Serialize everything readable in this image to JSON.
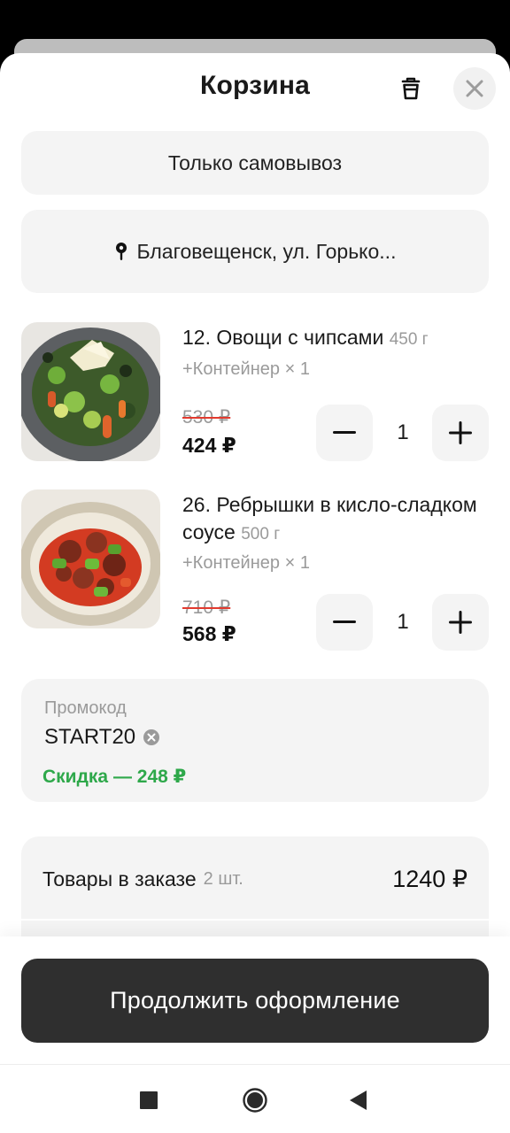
{
  "header": {
    "title": "Корзина"
  },
  "icons": {
    "trash": "trash-icon",
    "close": "close-icon",
    "pin": "location-pin-icon",
    "minus": "minus-icon",
    "plus": "plus-icon",
    "clear": "clear-circle-icon",
    "recents": "square-icon",
    "home": "circle-icon",
    "back": "triangle-back-icon"
  },
  "delivery": {
    "mode_label": "Только самовывоз",
    "address": "Благовещенск, ул. Горько..."
  },
  "items": [
    {
      "name": "12. Овощи с чипсами",
      "weight": "450 г",
      "addon": "+Контейнер × 1",
      "old_price": "530 ₽",
      "price": "424 ₽",
      "qty": "1"
    },
    {
      "name": "26. Ребрышки в кисло-сладком соусе",
      "weight": "500 г",
      "addon": "+Контейнер × 1",
      "old_price": "710 ₽",
      "price": "568 ₽",
      "qty": "1"
    }
  ],
  "promo": {
    "label": "Промокод",
    "code": "START20",
    "discount": "Скидка — 248 ₽"
  },
  "summary": {
    "items_label": "Товары в заказе",
    "items_count": "2 шт.",
    "items_total": "1240 ₽"
  },
  "cta": {
    "label": "Продолжить оформление"
  },
  "colors": {
    "accent_green": "#2ea84a",
    "strike_red": "#e23a2e",
    "cta_bg": "#2f2f2f",
    "pill_bg": "#f4f4f4"
  }
}
